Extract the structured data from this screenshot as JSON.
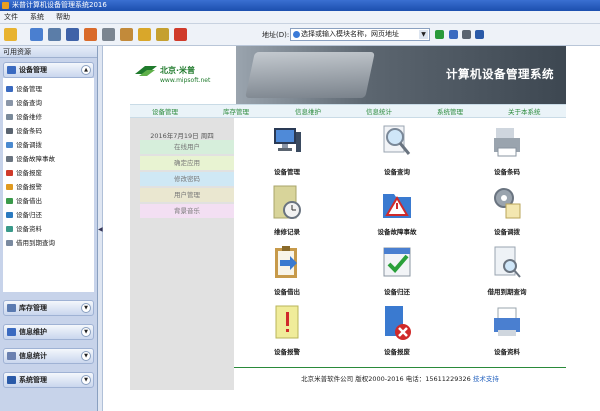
{
  "window": {
    "title": "米普计算机设备管理系统2016"
  },
  "menu": [
    "文件",
    "系统",
    "帮助"
  ],
  "address": {
    "label": "地址(D):",
    "placeholder": "选择或输入模块名称，网页地址"
  },
  "sidebar": {
    "header": "可用资源",
    "groups": [
      {
        "label": "设备管理",
        "expanded": true,
        "items": [
          "设备管理",
          "设备查询",
          "设备维修",
          "设备条码",
          "设备调拨",
          "设备故障事故",
          "设备报废",
          "设备报警",
          "设备借出",
          "设备归还",
          "设备资料",
          "借用到期查询"
        ]
      },
      {
        "label": "库存管理",
        "expanded": false
      },
      {
        "label": "信息维护",
        "expanded": false
      },
      {
        "label": "信息统计",
        "expanded": false
      },
      {
        "label": "系统管理",
        "expanded": false
      }
    ]
  },
  "banner": {
    "logo_title": "北京·米普",
    "logo_url": "www.mipsoft.net",
    "title": "计算机设备管理系统"
  },
  "nav": [
    "设备管理",
    "库存管理",
    "信息维护",
    "信息统计",
    "系统管理",
    "关于本系统"
  ],
  "left_panel": {
    "date": "2016年7月19日 周四",
    "items": [
      {
        "label": "在线用户",
        "bg": "#d6eedb"
      },
      {
        "label": "确定应用",
        "bg": "#e8f3d2"
      },
      {
        "label": "修改密码",
        "bg": "#cfe8f5"
      },
      {
        "label": "用户管理",
        "bg": "#eae7d0"
      },
      {
        "label": "背景音乐",
        "bg": "#f3dff3"
      }
    ]
  },
  "grid": [
    {
      "label": "设备管理",
      "icon": "computer-icon"
    },
    {
      "label": "设备查询",
      "icon": "magnifier-icon"
    },
    {
      "label": "设备条码",
      "icon": "printer-icon"
    },
    {
      "label": "维修记录",
      "icon": "clock-folder-icon"
    },
    {
      "label": "设备故障事故",
      "icon": "warning-folder-icon"
    },
    {
      "label": "设备调拨",
      "icon": "gear-list-icon"
    },
    {
      "label": "设备借出",
      "icon": "clipboard-arrow-icon"
    },
    {
      "label": "设备归还",
      "icon": "calendar-check-icon"
    },
    {
      "label": "借用到期查询",
      "icon": "document-search-icon"
    },
    {
      "label": "设备报警",
      "icon": "alert-note-icon"
    },
    {
      "label": "设备报废",
      "icon": "delete-document-icon"
    },
    {
      "label": "设备资料",
      "icon": "fax-icon"
    }
  ],
  "footer": {
    "company": "北京米普软件公司",
    "copyright": "版权2000-2016",
    "phone": "电话：15611229326",
    "support": "技术支持"
  },
  "colors": {
    "accent_green": "#2a8a3a",
    "sidebar_bg": "#c7d3ea",
    "titlebar": "#1c4fae"
  }
}
